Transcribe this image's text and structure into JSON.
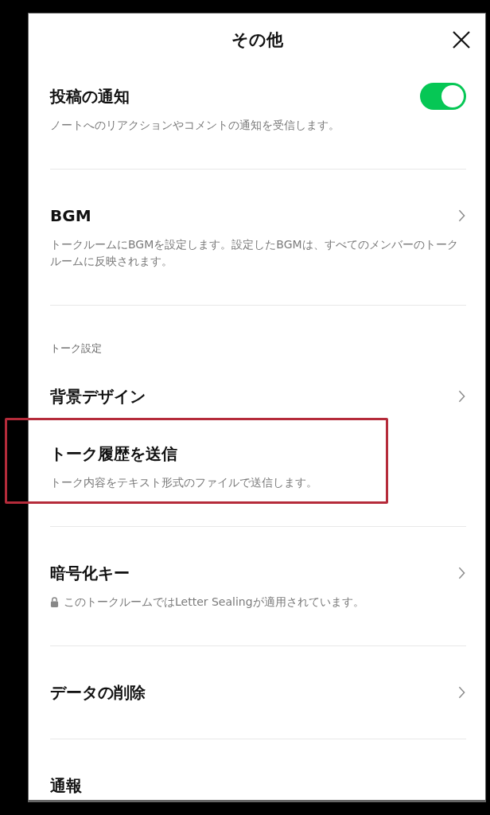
{
  "header": {
    "title": "その他"
  },
  "groups": [
    {
      "items": [
        {
          "kind": "toggle",
          "label": "投稿の通知",
          "description": "ノートへのリアクションやコメントの通知を受信します。",
          "on": true
        }
      ]
    },
    {
      "items": [
        {
          "kind": "link",
          "label": "BGM",
          "description": "トークルームにBGMを設定します。設定したBGMは、すべてのメンバーのトークルームに反映されます。"
        }
      ]
    },
    {
      "items": [
        {
          "kind": "header",
          "label": "トーク設定"
        },
        {
          "kind": "link",
          "label": "背景デザイン"
        },
        {
          "kind": "action",
          "label": "トーク履歴を送信",
          "description": "トーク内容をテキスト形式のファイルで送信します。",
          "highlighted": true
        }
      ]
    },
    {
      "items": [
        {
          "kind": "link",
          "label": "暗号化キー",
          "description": "このトークルームではLetter Sealingが適用されています。",
          "locked": true
        }
      ]
    },
    {
      "items": [
        {
          "kind": "link",
          "label": "データの削除"
        }
      ]
    },
    {
      "items": [
        {
          "kind": "action",
          "label": "通報"
        }
      ]
    }
  ]
}
